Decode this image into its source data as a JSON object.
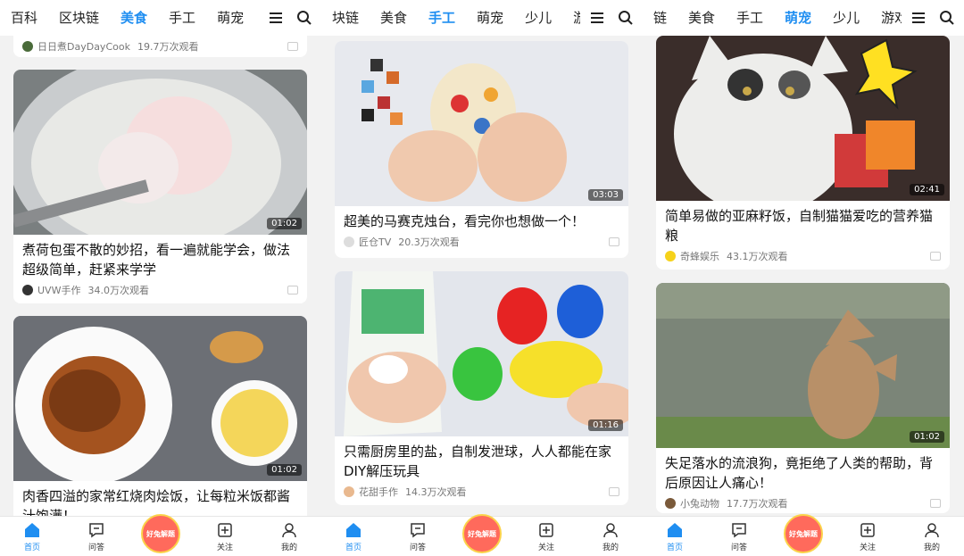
{
  "screens": [
    {
      "tabs": [
        "百科",
        "区块链",
        "美食",
        "手工",
        "萌宠"
      ],
      "active_tab": "美食",
      "partial_item": {
        "author": "日日煮DayDayCook",
        "views": "19.7万次观看"
      },
      "cards": [
        {
          "title": "煮荷包蛋不散的妙招，看一遍就能学会，做法超级简单，赶紧来学学",
          "author": "UVW手作",
          "views": "34.0万次观看",
          "duration": "01:02"
        },
        {
          "title": "肉香四溢的家常红烧肉烩饭，让每粒米饭都酱汁饱满！",
          "author": "",
          "views": "",
          "duration": "01:02"
        }
      ]
    },
    {
      "tabs": [
        "块链",
        "美食",
        "手工",
        "萌宠",
        "少儿",
        "游戏"
      ],
      "active_tab": "手工",
      "cards": [
        {
          "title": "超美的马赛克烛台，看完你也想做一个！",
          "author": "匠仓TV",
          "views": "20.3万次观看",
          "duration": "03:03"
        },
        {
          "title": "只需厨房里的盐，自制发泄球，人人都能在家DIY解压玩具",
          "author": "花甜手作",
          "views": "14.3万次观看",
          "duration": "01:16"
        }
      ]
    },
    {
      "tabs": [
        "链",
        "美食",
        "手工",
        "萌宠",
        "少儿",
        "游戏"
      ],
      "active_tab": "萌宠",
      "cards": [
        {
          "title": "简单易做的亚麻籽饭，自制猫猫爱吃的营养猫粮",
          "author": "奇蜂娱乐",
          "views": "43.1万次观看",
          "duration": "02:41"
        },
        {
          "title": "失足落水的流浪狗，竟拒绝了人类的帮助，背后原因让人痛心！",
          "author": "小兔动物",
          "views": "17.7万次观看",
          "duration": "01:02"
        }
      ]
    }
  ],
  "bottom_nav": {
    "home": "首页",
    "qa": "问答",
    "badge": "好兔解题",
    "follow": "关注",
    "mine": "我的"
  },
  "colors": {
    "accent": "#1f8ef1",
    "badge": "#ff6a5c"
  },
  "icons": [
    "menu-icon",
    "search-icon",
    "home-icon",
    "qa-icon",
    "follow-icon",
    "user-icon"
  ]
}
